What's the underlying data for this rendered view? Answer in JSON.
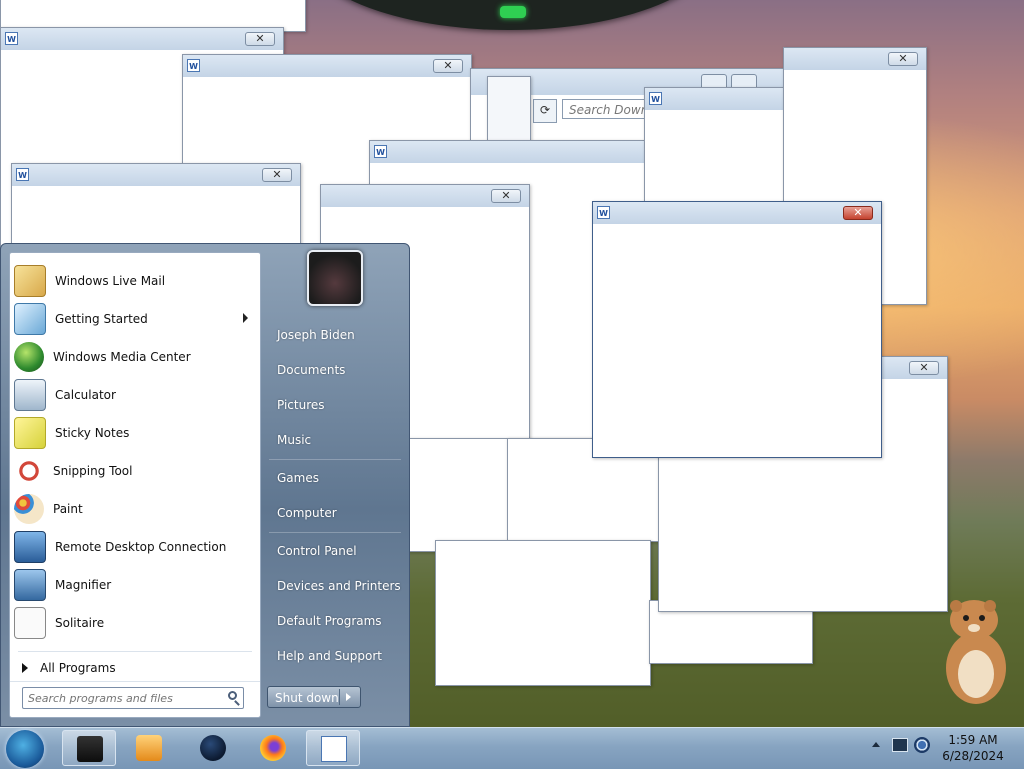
{
  "start_menu": {
    "programs": [
      {
        "label": "Windows Live Mail",
        "icon": "mail-icon",
        "submenu": false
      },
      {
        "label": "Getting Started",
        "icon": "getting-started-icon",
        "submenu": true
      },
      {
        "label": "Windows Media Center",
        "icon": "media-center-icon",
        "submenu": false
      },
      {
        "label": "Calculator",
        "icon": "calculator-icon",
        "submenu": false
      },
      {
        "label": "Sticky Notes",
        "icon": "sticky-notes-icon",
        "submenu": false
      },
      {
        "label": "Snipping Tool",
        "icon": "scissors-icon",
        "submenu": false
      },
      {
        "label": "Paint",
        "icon": "paint-palette-icon",
        "submenu": false
      },
      {
        "label": "Remote Desktop Connection",
        "icon": "remote-desktop-icon",
        "submenu": false
      },
      {
        "label": "Magnifier",
        "icon": "magnifier-icon",
        "submenu": false
      },
      {
        "label": "Solitaire",
        "icon": "solitaire-icon",
        "submenu": false
      }
    ],
    "all_programs": "All Programs",
    "search_placeholder": "Search programs and files",
    "right_items": [
      "Joseph Biden",
      "Documents",
      "Pictures",
      "Music",
      "Games",
      "Computer",
      "Control Panel",
      "Devices and Printers",
      "Default Programs",
      "Help and Support"
    ],
    "shutdown_label": "Shut down"
  },
  "background_window": {
    "search_placeholder": "Search Downl"
  },
  "taskbar": {
    "pinned": [
      {
        "name": "explorer-icon",
        "active": true
      },
      {
        "name": "media-player-icon",
        "active": false
      },
      {
        "name": "globe-icon",
        "active": false
      },
      {
        "name": "firefox-icon",
        "active": false
      },
      {
        "name": "wordpad-icon",
        "active": true
      }
    ],
    "clock_time": "1:59 AM",
    "clock_date": "6/28/2024"
  },
  "colors": {
    "taskbar": "#87a4c1",
    "start_menu_right": "#5f7690",
    "close_button_active": "#c4422f"
  }
}
